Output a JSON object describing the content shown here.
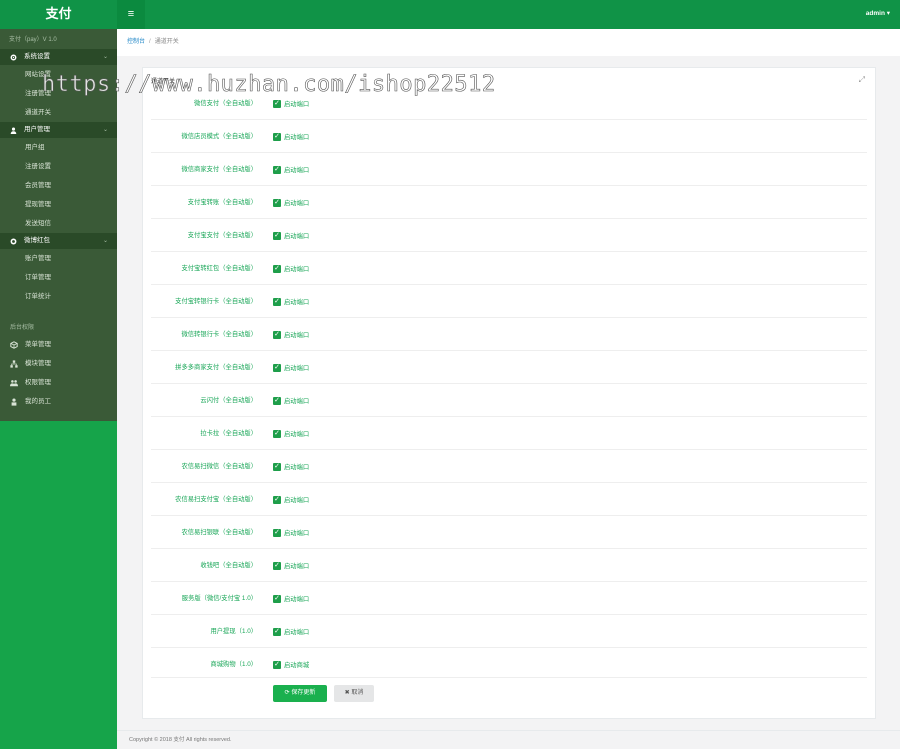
{
  "sidebar": {
    "logo": "支付",
    "version": "支付（pay）V 1.0",
    "groups": [
      {
        "label": "系统设置",
        "items": [
          "网站设置",
          "注册管理",
          "通道开关"
        ]
      },
      {
        "label": "用户管理",
        "items": [
          "用户组",
          "注册设置",
          "会员管理",
          "提现管理",
          "发送短信"
        ]
      },
      {
        "label": "微博红包",
        "items": [
          "账户管理",
          "订单管理",
          "订单统计"
        ]
      }
    ],
    "section_label": "后台权限",
    "menu": [
      "菜单管理",
      "模块管理",
      "权限管理",
      "我的员工"
    ]
  },
  "topbar": {
    "toggle": "≡",
    "user": "admin ▾"
  },
  "breadcrumb": {
    "home": "控制台",
    "sep": "/",
    "current": "通道开关"
  },
  "panel": {
    "title": "通道开关",
    "rows": [
      {
        "label": "微信支付（全自动版）",
        "check": "启动端口"
      },
      {
        "label": "微信店员模式（全自动版）",
        "check": "启动端口"
      },
      {
        "label": "微信商家支付（全自动版）",
        "check": "启动端口"
      },
      {
        "label": "支付宝转账（全自动版）",
        "check": "启动端口"
      },
      {
        "label": "支付宝支付（全自动版）",
        "check": "启动端口"
      },
      {
        "label": "支付宝转红包（全自动版）",
        "check": "启动端口"
      },
      {
        "label": "支付宝转银行卡（全自动版）",
        "check": "启动端口"
      },
      {
        "label": "微信转银行卡（全自动版）",
        "check": "启动端口"
      },
      {
        "label": "拼多多商家支付（全自动版）",
        "check": "启动端口"
      },
      {
        "label": "云闪付（全自动版）",
        "check": "启动端口"
      },
      {
        "label": "拉卡拉（全自动版）",
        "check": "启动端口"
      },
      {
        "label": "农信易扫微信（全自动版）",
        "check": "启动端口"
      },
      {
        "label": "农信易扫支付宝（全自动版）",
        "check": "启动端口"
      },
      {
        "label": "农信易扫银联（全自动版）",
        "check": "启动端口"
      },
      {
        "label": "收钱吧（全自动版）",
        "check": "启动端口"
      },
      {
        "label": "服务版（微信/支付宝 1.0）",
        "check": "启动端口"
      },
      {
        "label": "用户提现（1.0）",
        "check": "启动端口"
      },
      {
        "label": "商城购物（1.0）",
        "check": "启动商城"
      }
    ],
    "save_label": "⟳ 保存更新",
    "cancel_label": "✖ 取消"
  },
  "footer": "Copyright © 2018 支付 All rights reserved.",
  "watermark": "https://www.huzhan.com/ishop22512",
  "colors": {
    "brand": "#109347",
    "sidebar": "#3a5a37",
    "accent": "#18a657"
  }
}
